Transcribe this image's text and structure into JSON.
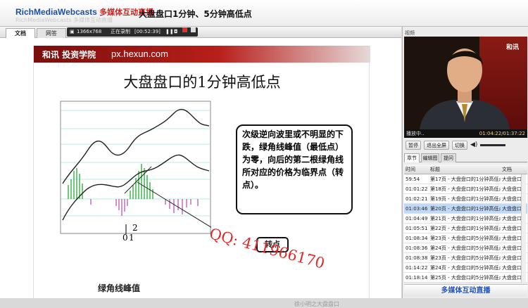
{
  "header": {
    "logo_en": "RichMediaWebcasts",
    "logo_cn": "多媒体互动直播",
    "logo_ghost": "RichMediaWebcasts 多媒体互动直播",
    "title": "大盘盘口1分钟、5分钟高低点"
  },
  "left_tabs": [
    {
      "label": "文档",
      "active": true
    },
    {
      "label": "网答",
      "active": false
    }
  ],
  "recorder": {
    "resolution": "1366x768",
    "status": "正在录制",
    "time": "[00:52:39]"
  },
  "slide": {
    "brand": "和讯 投资学院",
    "url": "px.hexun.com",
    "title": "大盘盘口的1分钟高低点",
    "callout": "次级逆向波里或不明显的下跌，绿角线峰值（最低点）为零，向后的第二根绿角线所对应的价格为临界点（转点）。",
    "turn_label": "转点",
    "green_label": "绿角线峰值",
    "mark_0": "0",
    "mark_1": "1",
    "mark_2": "2",
    "watermark": "QQ: 411966170",
    "footer": "徐小明之大盘盘口"
  },
  "right": {
    "video_label": "视频",
    "video_logo": "和讯",
    "status_left": "播放中..",
    "status_time": "01:04:22/01:37:22",
    "buttons": [
      "暂停",
      "退出全屏",
      "切换"
    ],
    "subtabs": [
      {
        "label": "章节",
        "active": true
      },
      {
        "label": "编辑图",
        "active": false
      },
      {
        "label": "提问",
        "active": false
      }
    ],
    "table": {
      "headers": [
        "时间",
        "标题",
        "文档"
      ],
      "rows": [
        {
          "time": "59:54",
          "title": "第17页 - 大盘盘口的1分钟高低点",
          "doc": "大盘盘口"
        },
        {
          "time": "01:01:22",
          "title": "第18页 - 大盘盘口的1分钟高低点",
          "doc": "大盘盘口"
        },
        {
          "time": "01:02:21",
          "title": "第19页 - 大盘盘口的1分钟高低点",
          "doc": "大盘盘口"
        },
        {
          "time": "01:03:46",
          "title": "第20页 - 大盘盘口的1分钟高低点",
          "doc": "大盘盘口"
        },
        {
          "time": "01:04:49",
          "title": "第21页 - 大盘盘口的1分钟高低点",
          "doc": "大盘盘口"
        },
        {
          "time": "01:05:51",
          "title": "第22页 - 大盘盘口的1分钟高低点",
          "doc": "大盘盘口"
        },
        {
          "time": "01:08:34",
          "title": "第23页 - 大盘盘口的5分钟高低点",
          "doc": "大盘盘口"
        },
        {
          "time": "01:08:36",
          "title": "第24页 - 大盘盘口的5分钟高低点",
          "doc": "大盘盘口"
        },
        {
          "time": "01:08:38",
          "title": "第23页 - 大盘盘口的5分钟高低点",
          "doc": "大盘盘口"
        },
        {
          "time": "01:14:22",
          "title": "第24页 - 大盘盘口的5分钟高低点",
          "doc": "大盘盘口"
        },
        {
          "time": "01:18:14",
          "title": "第25页 - 大盘盘口的5分钟高低点",
          "doc": "大盘盘口"
        }
      ],
      "selected_index": 3
    },
    "footer": "多媒体互动直播"
  }
}
